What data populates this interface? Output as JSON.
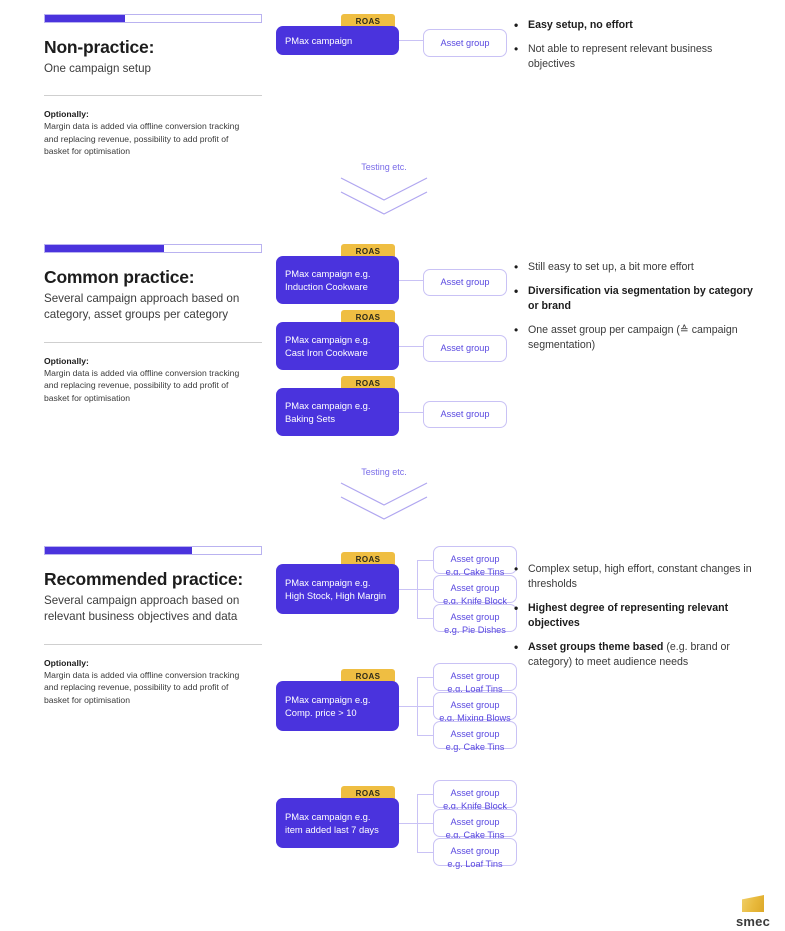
{
  "colors": {
    "brand_purple": "#4A33DD",
    "light_purple_border": "#C9C2F5",
    "roas_gold": "#EFBE42",
    "logo_gold": "#E8B93C",
    "text_dark": "#1C1C1C"
  },
  "sections": [
    {
      "progress_percent": 37,
      "title": "Non-practice:",
      "subtitle": "One campaign setup",
      "optional_label": "Optionally:",
      "optional_text": "Margin data is added via offline conversion tracking and replacing revenue, possibility to add profit of basket for optimisation",
      "campaigns": [
        {
          "roas": "ROAS",
          "campaign": "PMax campaign",
          "asset_groups": [
            {
              "title": "Asset group",
              "example": ""
            }
          ]
        }
      ],
      "bullets": [
        {
          "text": "Easy setup, no effort",
          "bold": true
        },
        {
          "text": "Not able to represent relevant business objectives",
          "bold": false
        }
      ]
    },
    {
      "progress_percent": 55,
      "title": "Common practice:",
      "subtitle": "Several campaign approach based on category, asset groups per category",
      "optional_label": "Optionally:",
      "optional_text": "Margin data is added via offline conversion tracking and replacing revenue, possibility to add profit of basket for optimisation",
      "campaigns": [
        {
          "roas": "ROAS",
          "campaign": "PMax campaign e.g. Induction Cookware",
          "asset_groups": [
            {
              "title": "Asset group",
              "example": ""
            }
          ]
        },
        {
          "roas": "ROAS",
          "campaign": "PMax campaign e.g. Cast Iron Cookware",
          "asset_groups": [
            {
              "title": "Asset group",
              "example": ""
            }
          ]
        },
        {
          "roas": "ROAS",
          "campaign": "PMax campaign e.g. Baking Sets",
          "asset_groups": [
            {
              "title": "Asset group",
              "example": ""
            }
          ]
        }
      ],
      "bullets": [
        {
          "text": "Still easy to set up, a bit more effort",
          "bold": false
        },
        {
          "text": "Diversification via segmentation by category or brand",
          "bold": true
        },
        {
          "text": "One asset group per campaign (≙ campaign segmentation)",
          "bold": false
        }
      ]
    },
    {
      "progress_percent": 68,
      "title": "Recommended practice:",
      "subtitle": "Several campaign approach based on relevant business objectives and data",
      "optional_label": "Optionally:",
      "optional_text": "Margin data is added via offline conversion tracking and replacing revenue, possibility to add profit of basket for optimisation",
      "campaigns": [
        {
          "roas": "ROAS",
          "campaign": "PMax campaign e.g. High Stock, High Margin",
          "asset_groups": [
            {
              "title": "Asset group",
              "example": "e.g. Cake Tins"
            },
            {
              "title": "Asset group",
              "example": "e.g. Knife Block"
            },
            {
              "title": "Asset group",
              "example": "e.g. Pie Dishes"
            }
          ]
        },
        {
          "roas": "ROAS",
          "campaign": "PMax campaign e.g. Comp. price > 10",
          "asset_groups": [
            {
              "title": "Asset group",
              "example": "e.g. Loaf Tins"
            },
            {
              "title": "Asset group",
              "example": "e.g. Mixing Blows"
            },
            {
              "title": "Asset group",
              "example": "e.g. Cake Tins"
            }
          ]
        },
        {
          "roas": "ROAS",
          "campaign": "PMax campaign e.g. item added last 7 days",
          "asset_groups": [
            {
              "title": "Asset group",
              "example": "e.g. Knife Block"
            },
            {
              "title": "Asset group",
              "example": "e.g. Cake Tins"
            },
            {
              "title": "Asset group",
              "example": "e.g. Loaf Tins"
            }
          ]
        }
      ],
      "bullets": [
        {
          "text": "Complex setup, high effort, constant changes in thresholds",
          "bold": false
        },
        {
          "text": "Highest degree of representing relevant objectives",
          "bold": true
        },
        {
          "text": "Asset groups theme based",
          "bold": true,
          "suffix": " (e.g. brand or category) to meet audience needs"
        }
      ]
    }
  ],
  "transitions": [
    {
      "label": "Testing etc."
    },
    {
      "label": "Testing etc."
    }
  ],
  "logo": {
    "text": "smec",
    "mark": "smec-logo-mark"
  }
}
